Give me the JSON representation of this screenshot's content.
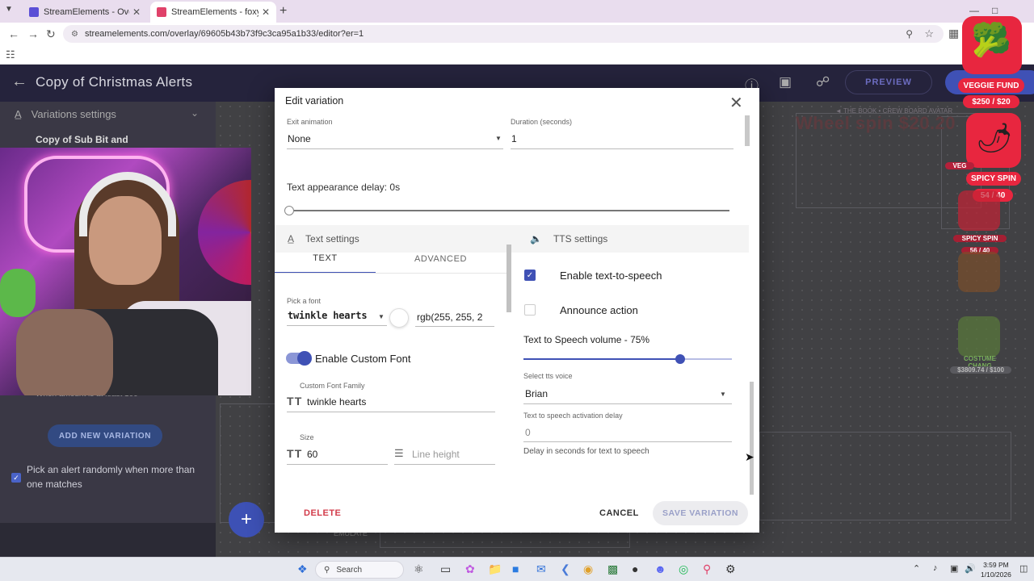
{
  "browser": {
    "tabs": [
      {
        "title": "StreamElements - Overlays",
        "active": false
      },
      {
        "title": "StreamElements - foxyzilla",
        "active": true
      }
    ],
    "url": "streamelements.com/overlay/69605b43b73f9c3ca95a1b33/editor?er=1"
  },
  "app_header": {
    "title": "Copy of Christmas Alerts",
    "preview_label": "PREVIEW"
  },
  "left_panel": {
    "variations_settings": "Variations settings",
    "sub_title": "Copy of Sub Bit and",
    "condition_text": "When amount is at least 100",
    "add_variation_label": "ADD NEW VARIATION",
    "pick_random_label": "Pick an alert randomly when more than one matches"
  },
  "canvas": {
    "wheel_text": "Wheel spin $20.20",
    "book_text": "◄ THE BOOK • CREW BOARD AVATAR",
    "emulate_label": "EMULATE"
  },
  "goals": {
    "veggie_label": "VEGGIE FUND",
    "veggie_amount": "$250 / $20",
    "spicy_label": "SPICY SPIN",
    "spicy_count": "54 / 40",
    "spicy2_label": "SPICY SPIN",
    "spicy2_count": "56 / 40",
    "vegg_partial": "VEG",
    "costume_label": "COSTUME CHANG",
    "costume_amount": "$3809.74 / $100"
  },
  "modal": {
    "title": "Edit variation",
    "exit_animation_label": "Exit animation",
    "exit_animation_value": "None",
    "duration_label": "Duration (seconds)",
    "duration_value": "1",
    "text_delay": "Text appearance delay: 0s",
    "text_settings_label": "Text settings",
    "tts_settings_label": "TTS settings",
    "tab_text": "TEXT",
    "tab_advanced": "ADVANCED",
    "pick_font_label": "Pick a font",
    "font_value": "twinkle hearts",
    "color_value": "rgb(255, 255, 2",
    "enable_custom_font": "Enable Custom Font",
    "custom_font_family_label": "Custom Font Family",
    "custom_font_family_value": "twinkle hearts",
    "size_label": "Size",
    "size_value": "60",
    "line_height_placeholder": "Line height",
    "enable_tts": "Enable text-to-speech",
    "announce_action": "Announce action",
    "tts_volume_label": "Text to Speech volume - 75%",
    "tts_volume": 0.75,
    "tts_voice_label": "Select tts voice",
    "tts_voice_value": "Brian",
    "tts_delay_label": "Text to speech activation delay",
    "tts_delay_value": "0",
    "tts_delay_help": "Delay in seconds for text to speech",
    "delete_label": "DELETE",
    "cancel_label": "CANCEL",
    "save_label": "SAVE VARIATION"
  },
  "taskbar": {
    "search_label": "Search",
    "time": "3:59 PM",
    "date": "1/10/2026"
  },
  "colors": {
    "accent": "#3f51b5",
    "delete": "#d23b4a",
    "header": "#25233c"
  }
}
